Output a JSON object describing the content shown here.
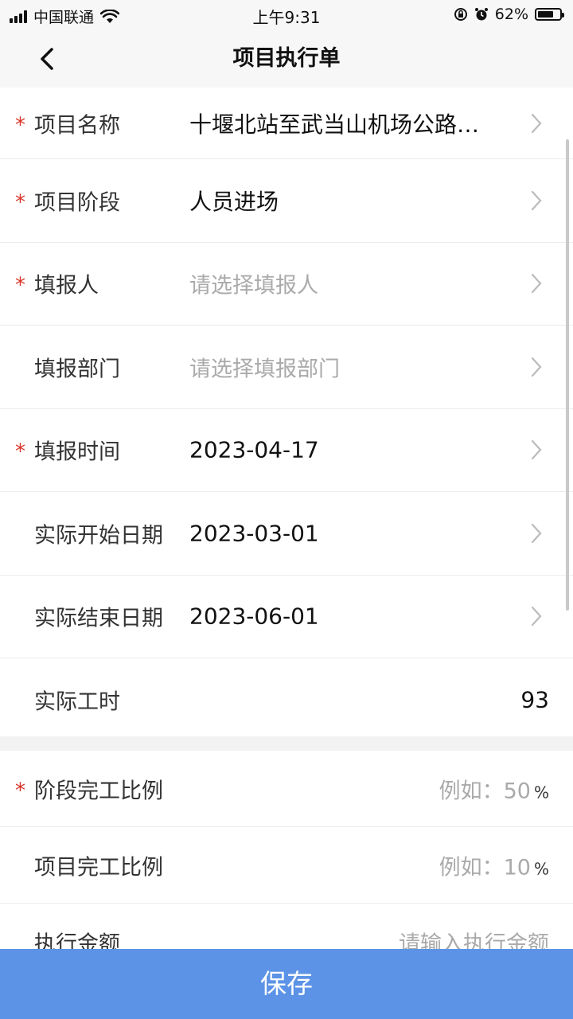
{
  "status_bar": {
    "carrier": "中国联通",
    "time": "上午9:31",
    "battery": "62%",
    "icons": [
      "signal-icon",
      "wifi-icon",
      "rotation-lock-icon",
      "alarm-icon",
      "battery-icon"
    ]
  },
  "nav": {
    "title": "项目执行单",
    "back_icon": "chevron-left-icon"
  },
  "form": {
    "project_name": {
      "label": "项目名称",
      "value": "十堰北站至武当山机场公路…",
      "required": true
    },
    "project_stage": {
      "label": "项目阶段",
      "value": "人员进场",
      "required": true
    },
    "reporter": {
      "label": "填报人",
      "placeholder": "请选择填报人",
      "required": true
    },
    "report_dept": {
      "label": "填报部门",
      "placeholder": "请选择填报部门",
      "required": false
    },
    "report_time": {
      "label": "填报时间",
      "value": "2023-04-17",
      "required": true
    },
    "actual_start": {
      "label": "实际开始日期",
      "value": "2023-03-01",
      "required": false
    },
    "actual_end": {
      "label": "实际结束日期",
      "value": "2023-06-01",
      "required": false
    },
    "actual_hours": {
      "label": "实际工时",
      "value": "93",
      "required": false
    }
  },
  "form2": {
    "stage_ratio": {
      "label": "阶段完工比例",
      "placeholder": "例如：50",
      "unit": "%",
      "required": true
    },
    "project_ratio": {
      "label": "项目完工比例",
      "placeholder": "例如：10",
      "unit": "%",
      "required": false
    },
    "amount": {
      "label": "执行金额",
      "placeholder": "请输入执行金额",
      "required": false
    }
  },
  "save_label": "保存",
  "colors": {
    "accent": "#5c93e6",
    "required_star": "#d9362b",
    "placeholder": "#aaaaaa"
  }
}
